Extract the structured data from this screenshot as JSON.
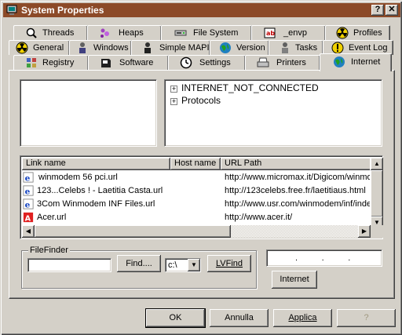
{
  "window": {
    "title": "System Properties",
    "help_btn": "?",
    "close_btn": "✕"
  },
  "tabs": {
    "row1": [
      {
        "name": "threads",
        "label": "Threads",
        "icon": "magnifier-icon"
      },
      {
        "name": "heaps",
        "label": "Heaps",
        "icon": "heaps-icon"
      },
      {
        "name": "file-system",
        "label": "File System",
        "icon": "drive-icon"
      },
      {
        "name": "envp",
        "label": "_envp",
        "icon": "ab-icon"
      },
      {
        "name": "profiles",
        "label": "Profiles",
        "icon": "radiation-icon"
      }
    ],
    "row2": [
      {
        "name": "general",
        "label": "General",
        "icon": "radiation-icon"
      },
      {
        "name": "windows",
        "label": "Windows",
        "icon": "person-icon"
      },
      {
        "name": "simple-mapi",
        "label": "Simple MAPI",
        "icon": "person-icon"
      },
      {
        "name": "version",
        "label": "Version",
        "icon": "globe-icon"
      },
      {
        "name": "tasks",
        "label": "Tasks",
        "icon": "person-icon"
      },
      {
        "name": "event-log",
        "label": "Event Log",
        "icon": "warning-icon"
      }
    ],
    "row3": [
      {
        "name": "registry",
        "label": "Registry",
        "icon": "registry-icon"
      },
      {
        "name": "software",
        "label": "Software",
        "icon": "software-icon"
      },
      {
        "name": "settings",
        "label": "Settings",
        "icon": "clock-icon"
      },
      {
        "name": "printers",
        "label": "Printers",
        "icon": "printer-icon"
      },
      {
        "name": "internet",
        "label": "Internet",
        "icon": "globe-icon"
      }
    ]
  },
  "tree": {
    "items": [
      "INTERNET_NOT_CONNECTED",
      "Protocols"
    ]
  },
  "list": {
    "columns": [
      "Link name",
      "Host name",
      "URL Path"
    ],
    "rows": [
      {
        "name": "winmodem 56 pci.url",
        "host": "",
        "url": "http://www.micromax.it/Digicom/winmodem"
      },
      {
        "name": "123...Celebs ! - Laetitia Casta.url",
        "host": "",
        "url": "http://123celebs.free.fr/laetitiaus.html"
      },
      {
        "name": "3Com Winmodem INF Files.url",
        "host": "",
        "url": "http://www.usr.com/winmodem/inf/index"
      },
      {
        "name": "Acer.url",
        "host": "",
        "url": "http://www.acer.it/"
      }
    ]
  },
  "filefinder": {
    "group_label": "FileFinder",
    "input_value": "",
    "find_btn": "Find....",
    "drive_value": "c:\\",
    "lvfind_btn": "LVFind"
  },
  "ip_field": {
    "value": ".          .          ."
  },
  "internet_btn": "Internet",
  "footer": {
    "ok": "OK",
    "cancel": "Annulla",
    "apply": "Applica",
    "help": "?"
  },
  "colors": {
    "titlebar": "#8c4a28",
    "face": "#d4d0c8"
  }
}
